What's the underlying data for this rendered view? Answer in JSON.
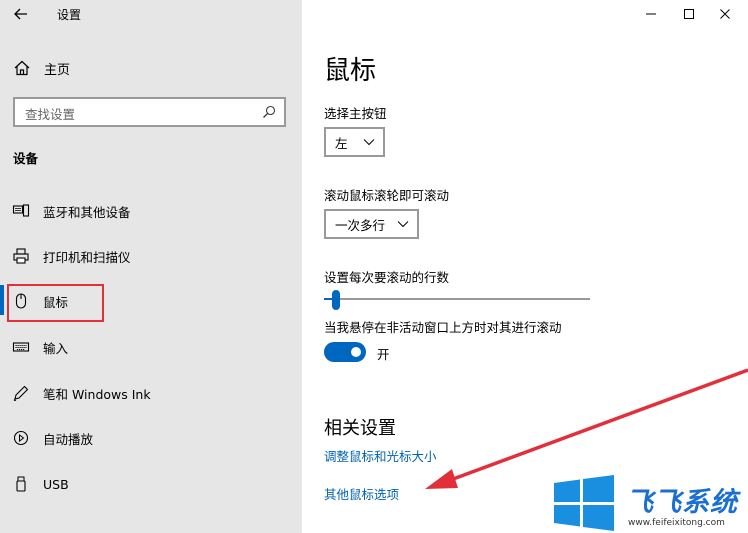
{
  "window": {
    "title": "设置"
  },
  "sidebar": {
    "home_label": "主页",
    "search_placeholder": "查找设置",
    "section_label": "设备",
    "items": [
      {
        "label": "蓝牙和其他设备",
        "icon": "bluetooth-devices-icon"
      },
      {
        "label": "打印机和扫描仪",
        "icon": "printer-icon"
      },
      {
        "label": "鼠标",
        "icon": "mouse-icon",
        "active": true
      },
      {
        "label": "输入",
        "icon": "keyboard-icon"
      },
      {
        "label": "笔和 Windows Ink",
        "icon": "pen-icon"
      },
      {
        "label": "自动播放",
        "icon": "autoplay-icon"
      },
      {
        "label": "USB",
        "icon": "usb-icon"
      }
    ]
  },
  "main": {
    "title": "鼠标",
    "primary_button_label": "选择主按钮",
    "primary_button_value": "左",
    "scroll_label": "滚动鼠标滚轮即可滚动",
    "scroll_value": "一次多行",
    "lines_label": "设置每次要滚动的行数",
    "lines_slider_fraction": 0.03,
    "inactive_scroll_label": "当我悬停在非活动窗口上方时对其进行滚动",
    "inactive_scroll_state": "开",
    "related_heading": "相关设置",
    "link_adjust": "调整鼠标和光标大小",
    "link_other": "其他鼠标选项"
  },
  "colors": {
    "accent": "#0067c0",
    "link": "#0063b1",
    "annotation_red": "#e2303a",
    "sidebar_bg": "#e6e6e6"
  },
  "watermark": {
    "logo_text": "飞飞系统",
    "url": "www.feifeixitong.com"
  }
}
